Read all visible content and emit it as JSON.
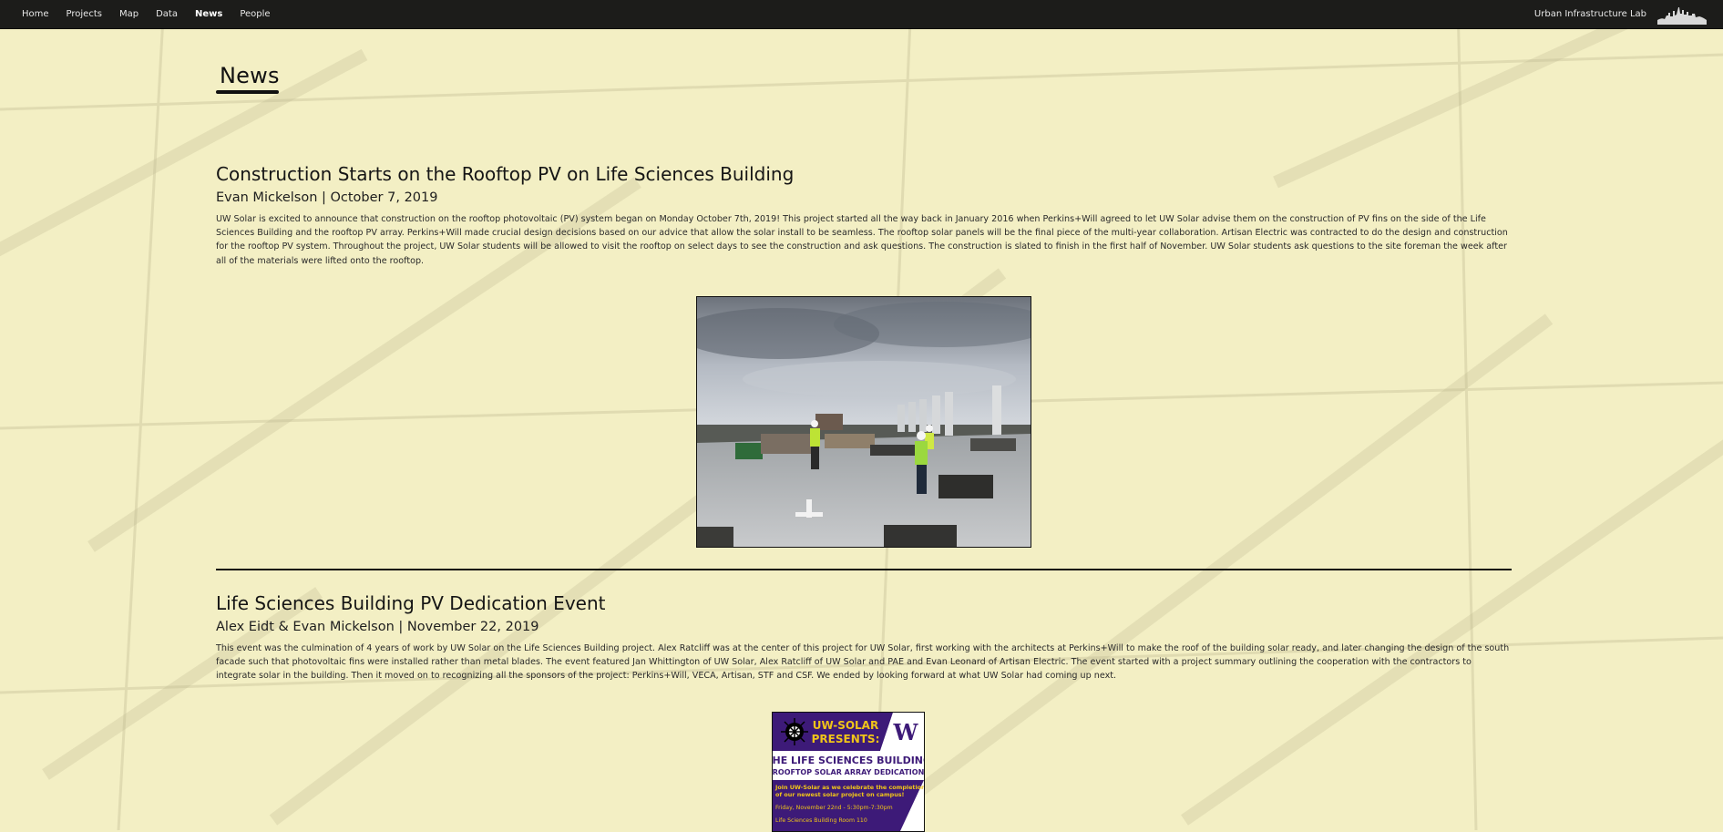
{
  "nav": {
    "items": [
      {
        "label": "Home",
        "active": false
      },
      {
        "label": "Projects",
        "active": false
      },
      {
        "label": "Map",
        "active": false
      },
      {
        "label": "Data",
        "active": false
      },
      {
        "label": "News",
        "active": true
      },
      {
        "label": "People",
        "active": false
      }
    ],
    "brand": "Urban Infrastructure Lab",
    "logo_icon": "seattle-skyline-icon"
  },
  "page": {
    "title": "News"
  },
  "articles": [
    {
      "title": "Construction Starts on the Rooftop PV on Life Sciences Building",
      "meta": "Evan Mickelson | October 7, 2019",
      "body": "UW Solar is excited to announce that construction on the rooftop photovoltaic (PV) system began on Monday October 7th, 2019! This project started all the way back in January 2016 when Perkins+Will agreed to let UW Solar advise them on the construction of PV fins on the side of the Life Sciences Building and the rooftop PV array. Perkins+Will made crucial design decisions based on our advice that allow the solar install to be seamless. The rooftop solar panels will be the final piece of the multi-year collaboration. Artisan Electric was contracted to do the design and construction for the rooftop PV system. Throughout the project, UW Solar students will be allowed to visit the rooftop on select days to see the construction and ask questions. The construction is slated to finish in the first half of November. UW Solar students ask questions to the site foreman the week after all of the materials were lifted onto the rooftop."
    },
    {
      "title": "Life Sciences Building PV Dedication Event",
      "meta": "Alex Eidt & Evan Mickelson | November 22, 2019",
      "body": "This event was the culmination of 4 years of work by UW Solar on the Life Sciences Building project. Alex Ratcliff was at the center of this project for UW Solar, first working with the architects at Perkins+Will to make the roof of the building solar ready, and later changing the design of the south facade such that photovoltaic fins were installed rather than metal blades. The event featured Jan Whittington of UW Solar, Alex Ratcliff of UW Solar and PAE and Evan Leonard of Artisan Electric. The event started with a project summary outlining the cooperation with the contractors to integrate solar in the building. Then it moved on to recognizing all the sponsors of the project: Perkins+Will, VECA, Artisan, STF and CSF. We ended by looking forward at what UW Solar had coming up next."
    }
  ],
  "poster": {
    "line1": "UW-SOLAR",
    "line2": "PRESENTS:",
    "logo": "W",
    "headline": "THE LIFE SCIENCES BUILDING",
    "subhead": "ROOFTOP SOLAR ARRAY DEDICATION",
    "invite1": "Join UW-Solar as we celebrate the completion",
    "invite2": "of our newest solar project on campus!",
    "when": "Friday, November 22nd - 5:30pm-7:30pm",
    "where": "Life Sciences Building Room 110",
    "colors": {
      "purple": "#3d1a78",
      "gold": "#f0c419"
    }
  }
}
